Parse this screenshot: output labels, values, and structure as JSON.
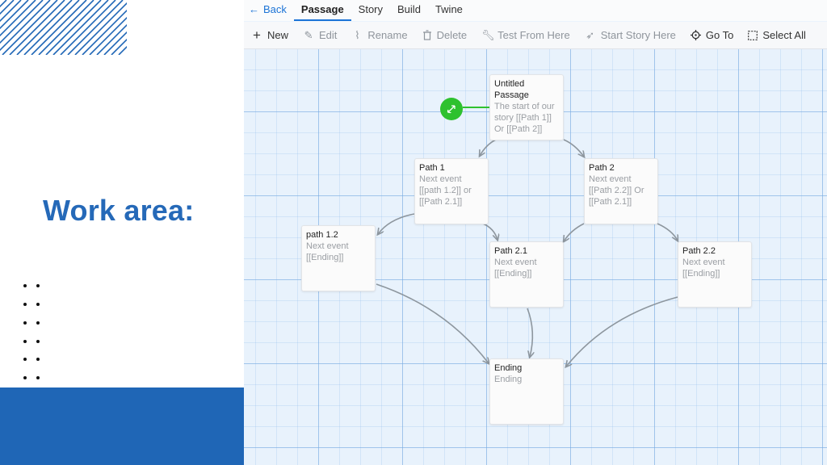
{
  "slide": {
    "title": "Work area:",
    "accent_color": "#1f66b6"
  },
  "topbar": {
    "back_label": "Back",
    "tabs": [
      {
        "label": "Passage",
        "active": true
      },
      {
        "label": "Story",
        "active": false
      },
      {
        "label": "Build",
        "active": false
      },
      {
        "label": "Twine",
        "active": false
      }
    ]
  },
  "toolbar": {
    "new_label": "New",
    "edit_label": "Edit",
    "rename_label": "Rename",
    "delete_label": "Delete",
    "test_label": "Test From Here",
    "start_label": "Start Story Here",
    "goto_label": "Go To",
    "selectall_label": "Select All"
  },
  "passages": {
    "untitled": {
      "title": "Untitled Passage",
      "excerpt": "The start of our story [[Path 1]] Or [[Path 2]]"
    },
    "path1": {
      "title": "Path 1",
      "excerpt": "Next event [[path 1.2]] or [[Path 2.1]]"
    },
    "path2": {
      "title": "Path 2",
      "excerpt": "Next event [[Path 2.2]] Or [[Path 2.1]]"
    },
    "path12": {
      "title": "path 1.2",
      "excerpt": "Next event [[Ending]]"
    },
    "path21": {
      "title": "Path 2.1",
      "excerpt": "Next event [[Ending]]"
    },
    "path22": {
      "title": "Path 2.2",
      "excerpt": "Next event [[Ending]]"
    },
    "ending": {
      "title": "Ending",
      "excerpt": "Ending"
    }
  },
  "colors": {
    "tab_active_underline": "#1b73d6",
    "start_marker": "#2ec12e",
    "link_arrow": "#8d969e"
  }
}
